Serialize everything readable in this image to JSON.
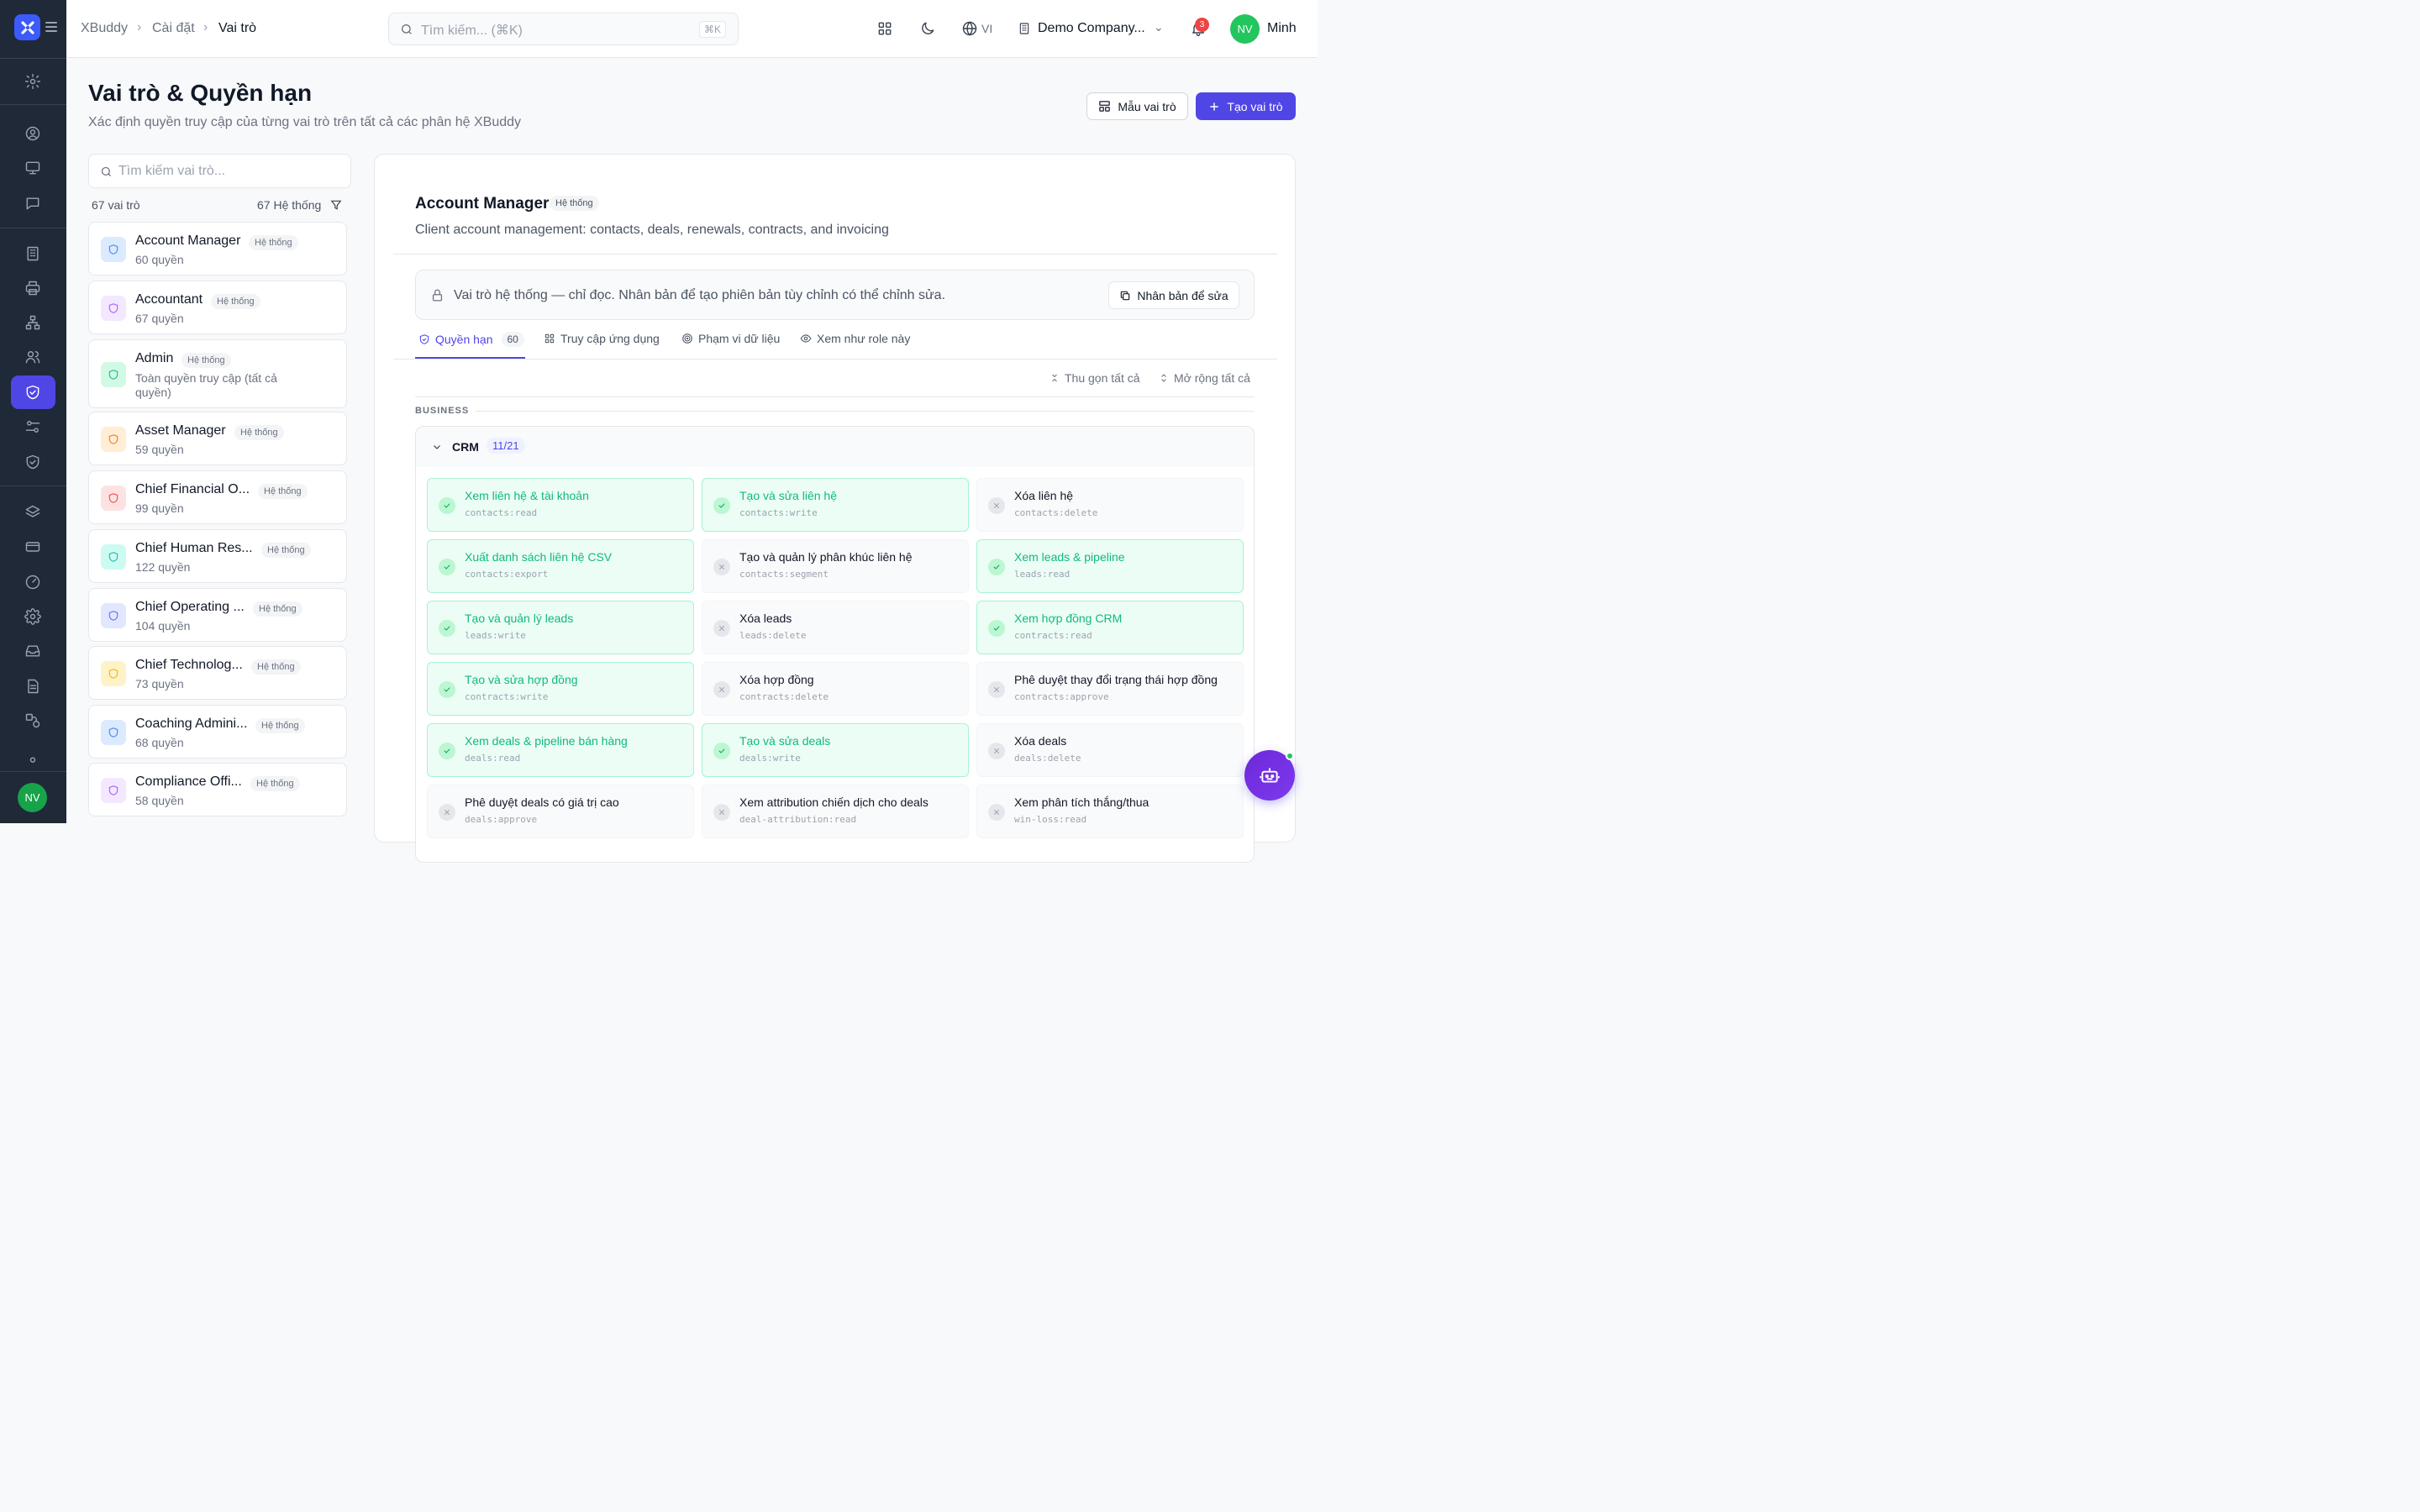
{
  "app": {
    "logo_icon": "xbuddy-logo-icon"
  },
  "breadcrumb": [
    "XBuddy",
    "Cài đặt",
    "Vai trò"
  ],
  "search": {
    "placeholder": "Tìm kiếm... (⌘K)",
    "shortcut": "⌘K"
  },
  "topbar": {
    "language": "VI",
    "company": "Demo Company...",
    "notifications": "3",
    "user_initials": "NV",
    "user_name": "Minh"
  },
  "sidebar": {
    "user_initials": "NV"
  },
  "page": {
    "title": "Vai trò & Quyền hạn",
    "subtitle": "Xác định quyền truy cập của từng vai trò trên tất cả các phân hệ XBuddy",
    "template_button": "Mẫu vai trò",
    "create_button": "Tạo vai trò"
  },
  "roles_panel": {
    "search_placeholder": "Tìm kiếm vai trò...",
    "count_label": "67 vai trò",
    "filter_label": "67 Hệ thống"
  },
  "roles": [
    {
      "name": "Account Manager",
      "tag": "Hệ thống",
      "perms": "60 quyền",
      "color": "#3b82f6",
      "bg": "#dbeafe"
    },
    {
      "name": "Accountant",
      "tag": "Hệ thống",
      "perms": "67 quyền",
      "color": "#a855f7",
      "bg": "#f3e8ff"
    },
    {
      "name": "Admin",
      "tag": "Hệ thống",
      "perms": "Toàn quyền truy cập (tất cả quyền)",
      "color": "#10b981",
      "bg": "#d1fae5"
    },
    {
      "name": "Asset Manager",
      "tag": "Hệ thống",
      "perms": "59 quyền",
      "color": "#f97316",
      "bg": "#ffedd5"
    },
    {
      "name": "Chief Financial O...",
      "tag": "Hệ thống",
      "perms": "99 quyền",
      "color": "#ef4444",
      "bg": "#fee2e2"
    },
    {
      "name": "Chief Human Res...",
      "tag": "Hệ thống",
      "perms": "122 quyền",
      "color": "#14b8a6",
      "bg": "#ccfbf1"
    },
    {
      "name": "Chief Operating ...",
      "tag": "Hệ thống",
      "perms": "104 quyền",
      "color": "#6366f1",
      "bg": "#e0e7ff"
    },
    {
      "name": "Chief Technolog...",
      "tag": "Hệ thống",
      "perms": "73 quyền",
      "color": "#eab308",
      "bg": "#fef3c7"
    },
    {
      "name": "Coaching Admini...",
      "tag": "Hệ thống",
      "perms": "68 quyền",
      "color": "#3b82f6",
      "bg": "#dbeafe"
    },
    {
      "name": "Compliance Offi...",
      "tag": "Hệ thống",
      "perms": "58 quyền",
      "color": "#a855f7",
      "bg": "#f3e8ff"
    }
  ],
  "detail": {
    "title": "Account Manager",
    "tag": "Hệ thống",
    "description": "Client account management: contacts, deals, renewals, contracts, and invoicing",
    "notice": "Vai trò hệ thống — chỉ đọc. Nhân bản để tạo phiên bản tùy chỉnh có thể chỉnh sửa.",
    "clone_button": "Nhân bản để sửa",
    "tabs": [
      {
        "label": "Quyền hạn",
        "count": "60"
      },
      {
        "label": "Truy cập ứng dụng"
      },
      {
        "label": "Phạm vi dữ liệu"
      },
      {
        "label": "Xem như role này"
      }
    ],
    "collapse_all": "Thu gọn tất cả",
    "expand_all": "Mở rộng tất cả",
    "section": "BUSINESS",
    "group": {
      "name": "CRM",
      "count": "11/21"
    }
  },
  "permissions": [
    {
      "label": "Xem liên hệ & tài khoản",
      "code": "contacts:read",
      "granted": true
    },
    {
      "label": "Tạo và sửa liên hệ",
      "code": "contacts:write",
      "granted": true
    },
    {
      "label": "Xóa liên hệ",
      "code": "contacts:delete",
      "granted": false
    },
    {
      "label": "Xuất danh sách liên hệ CSV",
      "code": "contacts:export",
      "granted": true
    },
    {
      "label": "Tạo và quản lý phân khúc liên hệ",
      "code": "contacts:segment",
      "granted": false
    },
    {
      "label": "Xem leads & pipeline",
      "code": "leads:read",
      "granted": true
    },
    {
      "label": "Tạo và quản lý leads",
      "code": "leads:write",
      "granted": true
    },
    {
      "label": "Xóa leads",
      "code": "leads:delete",
      "granted": false
    },
    {
      "label": "Xem hợp đồng CRM",
      "code": "contracts:read",
      "granted": true
    },
    {
      "label": "Tạo và sửa hợp đồng",
      "code": "contracts:write",
      "granted": true
    },
    {
      "label": "Xóa hợp đồng",
      "code": "contracts:delete",
      "granted": false
    },
    {
      "label": "Phê duyệt thay đổi trạng thái hợp đồng",
      "code": "contracts:approve",
      "granted": false
    },
    {
      "label": "Xem deals & pipeline bán hàng",
      "code": "deals:read",
      "granted": true
    },
    {
      "label": "Tạo và sửa deals",
      "code": "deals:write",
      "granted": true
    },
    {
      "label": "Xóa deals",
      "code": "deals:delete",
      "granted": false
    },
    {
      "label": "Phê duyệt deals có giá trị cao",
      "code": "deals:approve",
      "granted": false
    },
    {
      "label": "Xem attribution chiến dịch cho deals",
      "code": "deal-attribution:read",
      "granted": false
    },
    {
      "label": "Xem phân tích thắng/thua",
      "code": "win-loss:read",
      "granted": false
    }
  ]
}
